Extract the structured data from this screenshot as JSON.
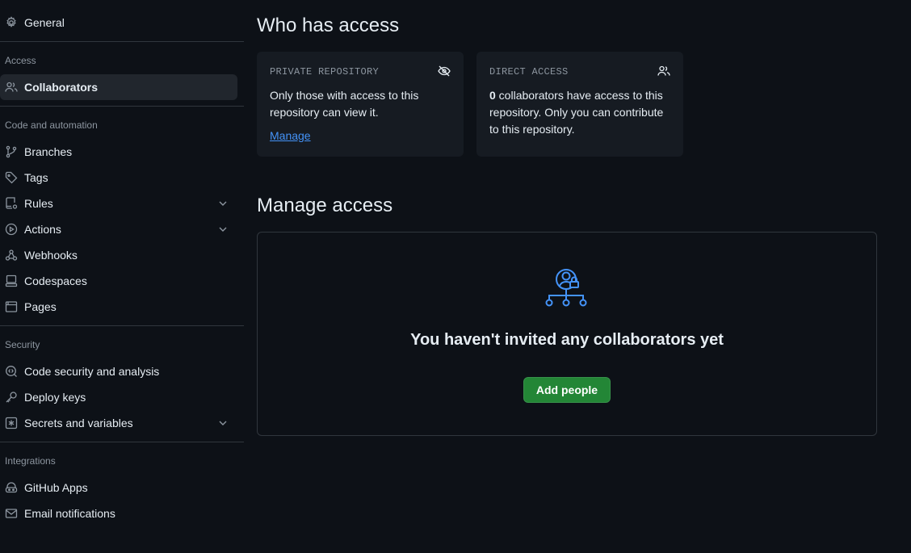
{
  "sidebar": {
    "general": "General",
    "access_heading": "Access",
    "collaborators": "Collaborators",
    "code_heading": "Code and automation",
    "branches": "Branches",
    "tags": "Tags",
    "rules": "Rules",
    "actions": "Actions",
    "webhooks": "Webhooks",
    "codespaces": "Codespaces",
    "pages": "Pages",
    "security_heading": "Security",
    "code_security": "Code security and analysis",
    "deploy_keys": "Deploy keys",
    "secrets": "Secrets and variables",
    "integrations_heading": "Integrations",
    "github_apps": "GitHub Apps",
    "email_notifications": "Email notifications"
  },
  "who_has_access": {
    "title": "Who has access",
    "private_card": {
      "kicker": "PRIVATE REPOSITORY",
      "body": "Only those with access to this repository can view it.",
      "link": "Manage"
    },
    "direct_card": {
      "kicker": "DIRECT ACCESS",
      "count": "0",
      "body": " collaborators have access to this repository. Only you can contribute to this repository."
    }
  },
  "manage_access": {
    "title": "Manage access",
    "blank_title": "You haven't invited any collaborators yet",
    "add_button": "Add people"
  },
  "icons": {
    "general": "gear-icon",
    "collaborators": "people-icon",
    "branches": "git-branch-icon",
    "tags": "tag-icon",
    "rules": "repo-rules-icon",
    "actions": "play-icon",
    "webhooks": "webhook-icon",
    "codespaces": "codespaces-icon",
    "pages": "browser-icon",
    "code_security": "codescan-icon",
    "deploy_keys": "key-icon",
    "secrets": "asterisk-icon",
    "github_apps": "apps-icon",
    "email_notifications": "mail-icon",
    "private": "eye-closed-icon",
    "direct": "people-icon"
  },
  "colors": {
    "background": "#0d1117",
    "card": "#161b22",
    "accent_link": "#4493f8",
    "primary_button": "#238636",
    "muted_text": "#8d96a0"
  }
}
